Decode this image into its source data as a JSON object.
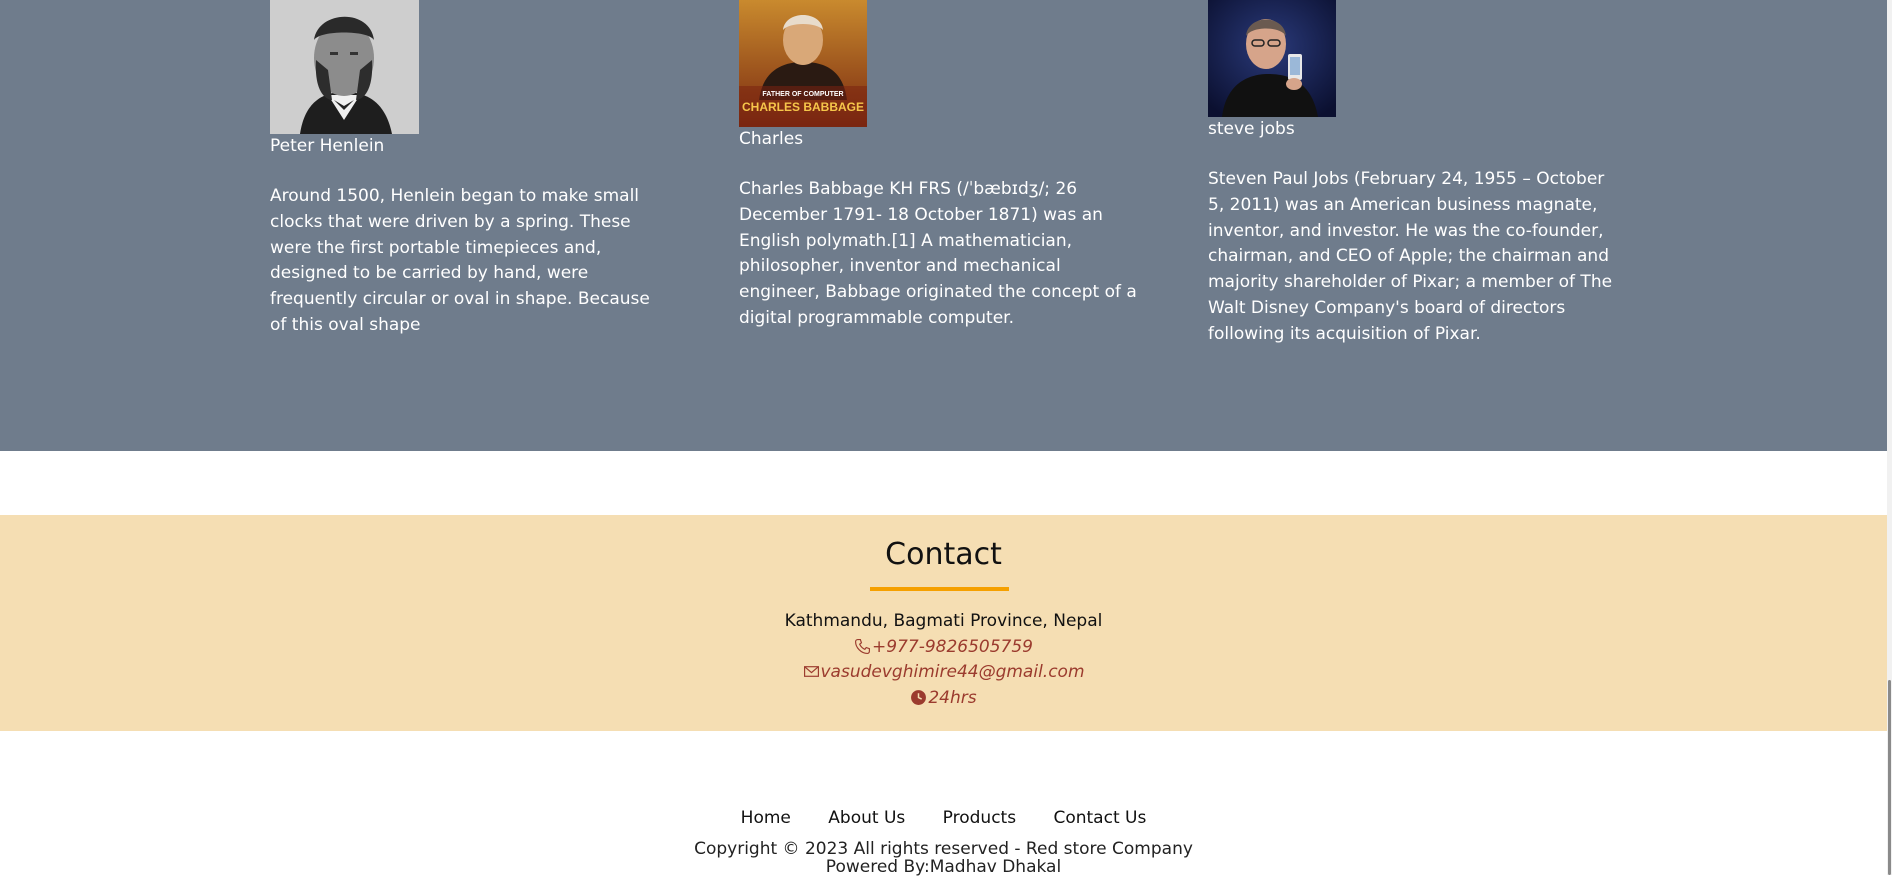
{
  "people": [
    {
      "name": "Peter Henlein",
      "bio": "Around 1500, Henlein began to make small clocks that were driven by a spring. These were the first portable timepieces and, designed to be carried by hand, were frequently circular or oval in shape. Because of this oval shape"
    },
    {
      "name": "Charles",
      "photo_caption_top": "FATHER OF COMPUTER",
      "photo_caption_main": "CHARLES BABBAGE",
      "bio": "Charles Babbage KH FRS (/ˈbæbɪdʒ/; 26 December 1791- 18 October 1871) was an English polymath.[1] A mathematician, philosopher, inventor and mechanical engineer, Babbage originated the concept of a digital programmable computer."
    },
    {
      "name": "steve jobs",
      "bio": "Steven Paul Jobs (February 24, 1955 – October 5, 2011) was an American business magnate, inventor, and investor. He was the co-founder, chairman, and CEO of Apple; the chairman and majority shareholder of Pixar; a member of The Walt Disney Company's board of directors following its acquisition of Pixar."
    }
  ],
  "contact": {
    "title": "Contact",
    "address": "Kathmandu, Bagmati Province, Nepal",
    "phone": "+977-9826505759",
    "email": "vasudevghimire44@gmail.com",
    "hours": "24hrs",
    "icons": [
      "phone-icon",
      "envelope-icon",
      "clock-icon"
    ]
  },
  "footer": {
    "nav": [
      "Home",
      "About Us",
      "Products",
      "Contact Us"
    ],
    "copyright": "Copyright © 2023 All rights reserved - Red store Company",
    "powered_by": "Powered By:Madhav Dhakal"
  },
  "colors": {
    "people_bg": "#6f7c8c",
    "contact_bg": "#f5deb3",
    "accent_underline": "#f5a000",
    "contact_link": "#9b3b2e"
  }
}
